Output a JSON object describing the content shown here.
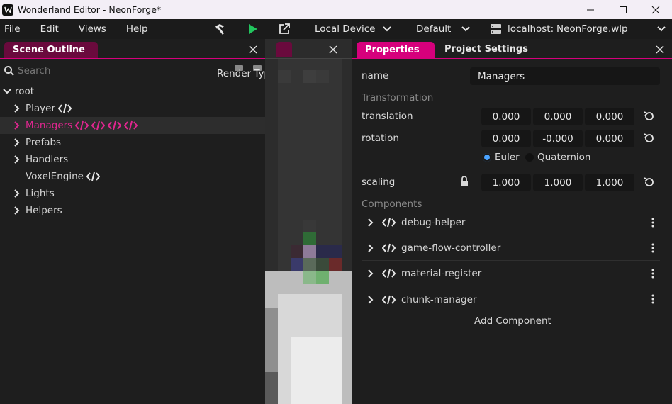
{
  "window": {
    "title": "Wonderland Editor - NeonForge*"
  },
  "menu": {
    "file": "File",
    "edit": "Edit",
    "views": "Views",
    "help": "Help"
  },
  "toolbar": {
    "device": "Local Device",
    "profile": "Default",
    "server_label": "localhost:",
    "project_file": "NeonForge.wlp"
  },
  "scene_outline": {
    "tab": "Scene Outline",
    "search_placeholder": "Search",
    "render_type": "Render Typ",
    "tree": [
      {
        "label": "root"
      },
      {
        "label": "Player"
      },
      {
        "label": "Managers"
      },
      {
        "label": "Prefabs"
      },
      {
        "label": "Handlers"
      },
      {
        "label": "VoxelEngine"
      },
      {
        "label": "Lights"
      },
      {
        "label": "Helpers"
      }
    ]
  },
  "properties": {
    "tab_properties": "Properties",
    "tab_project_settings": "Project Settings",
    "name_label": "name",
    "name_value": "Managers",
    "transformation": "Transformation",
    "translation_label": "translation",
    "translation": [
      "0.000",
      "0.000",
      "0.000"
    ],
    "rotation_label": "rotation",
    "rotation": [
      "0.000",
      "-0.000",
      "0.000"
    ],
    "euler": "Euler",
    "quaternion": "Quaternion",
    "scaling_label": "scaling",
    "scaling": [
      "1.000",
      "1.000",
      "1.000"
    ],
    "components_header": "Components",
    "components": [
      "debug-helper",
      "game-flow-controller",
      "material-register",
      "chunk-manager"
    ],
    "add_component": "Add Component"
  },
  "colors": {
    "accent": "#d6007c",
    "play": "#22c55e",
    "radio_selected": "#4aa3ff"
  }
}
